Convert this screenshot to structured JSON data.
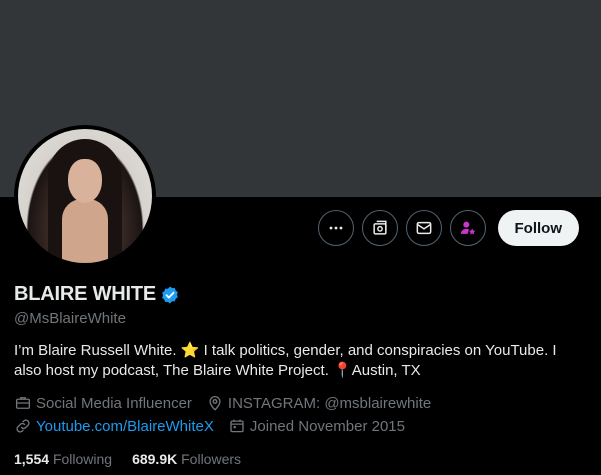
{
  "profile": {
    "display_name": "BLAIRE WHITE",
    "handle": "@MsBlaireWhite",
    "bio_part1": "I’m Blaire Russell White. ",
    "bio_star": "⭐",
    "bio_part2": " I talk politics, gender, and conspiracies on YouTube. I also host my podcast, The Blaire White Project. ",
    "bio_pin": "📍",
    "bio_part3": "Austin, TX",
    "category": "Social Media Influencer",
    "location": "INSTAGRAM: @msblairewhite",
    "website": "Youtube.com/BlaireWhiteX",
    "joined": "Joined November 2015",
    "following_count": "1,554",
    "following_label": "Following",
    "followers_count": "689.9K",
    "followers_label": "Followers"
  },
  "actions": {
    "follow_label": "Follow"
  },
  "icons": {
    "more": "more-icon",
    "grok": "grok-icon",
    "message": "message-icon",
    "subscribe": "subscribe-icon",
    "verified": "verified-badge-icon",
    "category": "briefcase-icon",
    "location": "location-pin-icon",
    "link": "link-icon",
    "calendar": "calendar-icon"
  },
  "colors": {
    "accent": "#1d9bf0",
    "subscribe": "#c936cc",
    "banner": "#333639"
  }
}
